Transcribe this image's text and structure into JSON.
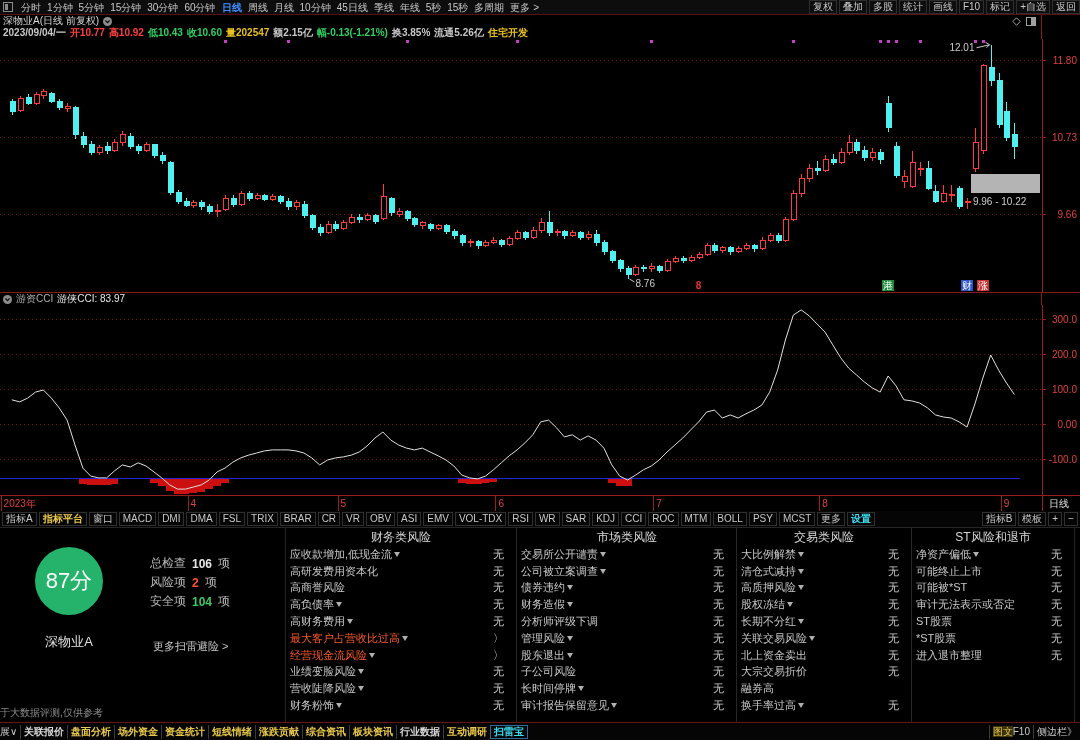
{
  "toolbar": {
    "periods": [
      {
        "label": "分时",
        "selected": false
      },
      {
        "label": "1分钟",
        "selected": false
      },
      {
        "label": "5分钟",
        "selected": false
      },
      {
        "label": "15分钟",
        "selected": false
      },
      {
        "label": "30分钟",
        "selected": false
      },
      {
        "label": "60分钟",
        "selected": false
      },
      {
        "label": "日线",
        "selected": true
      },
      {
        "label": "周线",
        "selected": false
      },
      {
        "label": "月线",
        "selected": false
      },
      {
        "label": "10分钟",
        "selected": false
      },
      {
        "label": "45日线",
        "selected": false
      },
      {
        "label": "季线",
        "selected": false
      },
      {
        "label": "年线",
        "selected": false
      },
      {
        "label": "5秒",
        "selected": false
      },
      {
        "label": "15秒",
        "selected": false
      },
      {
        "label": "多周期",
        "selected": false
      },
      {
        "label": "更多 >",
        "selected": false
      }
    ],
    "actions": [
      "复权",
      "叠加",
      "多股",
      "统计",
      "画线",
      "F10",
      "标记",
      "+自选",
      "返回"
    ]
  },
  "price_pane": {
    "title": "深物业A(日线 前复权)",
    "quote": [
      {
        "text": "2023/09/04/一",
        "color": "#c8c8c8"
      },
      {
        "text": "开10.77",
        "color": "#ff4040"
      },
      {
        "text": "高10.92",
        "color": "#ff4040"
      },
      {
        "text": "低10.43",
        "color": "#30d060"
      },
      {
        "text": "收10.60",
        "color": "#30d060"
      },
      {
        "text": "量202547",
        "color": "#e8c020"
      },
      {
        "text": "额2.15亿",
        "color": "#c8c8c8"
      },
      {
        "text": "幅-0.13(-1.21%)",
        "color": "#30d060"
      },
      {
        "text": "换3.85%",
        "color": "#c8c8c8"
      },
      {
        "text": "流通5.26亿",
        "color": "#c8c8c8"
      },
      {
        "text": "住宅开发",
        "color": "#e8c020"
      }
    ],
    "chart_data": {
      "type": "candlestick",
      "ylim": [
        8.58,
        12.09
      ],
      "yticks": [
        {
          "value": 11.8,
          "label": "11.80"
        },
        {
          "value": 10.73,
          "label": "10.73"
        },
        {
          "value": 9.66,
          "label": "9.66"
        }
      ],
      "tick_labels": "y",
      "grid": true,
      "ohlc": [
        null,
        [
          11.22,
          11.26,
          11.04,
          11.08
        ],
        [
          11.1,
          11.3,
          11.08,
          11.26
        ],
        [
          11.28,
          11.33,
          11.18,
          11.2
        ],
        [
          11.2,
          11.36,
          11.18,
          11.32
        ],
        [
          11.3,
          11.4,
          11.26,
          11.36
        ],
        [
          11.34,
          11.36,
          11.2,
          11.22
        ],
        [
          11.22,
          11.26,
          11.1,
          11.14
        ],
        [
          11.12,
          11.2,
          11.08,
          11.16
        ],
        [
          11.14,
          11.16,
          10.7,
          10.76
        ],
        [
          10.74,
          10.8,
          10.58,
          10.62
        ],
        [
          10.62,
          10.68,
          10.48,
          10.52
        ],
        [
          10.52,
          10.62,
          10.48,
          10.58
        ],
        [
          10.6,
          10.66,
          10.5,
          10.54
        ],
        [
          10.54,
          10.7,
          10.52,
          10.66
        ],
        [
          10.66,
          10.82,
          10.6,
          10.76
        ],
        [
          10.74,
          10.78,
          10.56,
          10.6
        ],
        [
          10.6,
          10.64,
          10.5,
          10.54
        ],
        [
          10.54,
          10.66,
          10.52,
          10.62
        ],
        [
          10.62,
          10.64,
          10.44,
          10.48
        ],
        [
          10.48,
          10.52,
          10.36,
          10.4
        ],
        [
          10.38,
          10.4,
          9.92,
          9.96
        ],
        [
          9.96,
          10.0,
          9.8,
          9.84
        ],
        [
          9.84,
          9.88,
          9.76,
          9.78
        ],
        [
          9.78,
          9.86,
          9.74,
          9.82
        ],
        [
          9.82,
          9.86,
          9.72,
          9.76
        ],
        [
          9.76,
          9.8,
          9.66,
          9.7
        ],
        [
          9.7,
          9.8,
          9.62,
          9.71
        ],
        [
          9.72,
          9.92,
          9.7,
          9.88
        ],
        [
          9.88,
          9.92,
          9.76,
          9.8
        ],
        [
          9.8,
          9.98,
          9.78,
          9.94
        ],
        [
          9.94,
          9.98,
          9.84,
          9.88
        ],
        [
          9.88,
          9.96,
          9.86,
          9.92
        ],
        [
          9.92,
          9.94,
          9.84,
          9.86
        ],
        [
          9.86,
          9.94,
          9.84,
          9.9
        ],
        [
          9.9,
          9.92,
          9.8,
          9.84
        ],
        [
          9.84,
          9.88,
          9.72,
          9.76
        ],
        [
          9.76,
          9.86,
          9.72,
          9.82
        ],
        [
          9.8,
          9.84,
          9.6,
          9.64
        ],
        [
          9.64,
          9.66,
          9.44,
          9.48
        ],
        [
          9.48,
          9.52,
          9.36,
          9.4
        ],
        [
          9.4,
          9.56,
          9.38,
          9.52
        ],
        [
          9.52,
          9.56,
          9.42,
          9.46
        ],
        [
          9.46,
          9.58,
          9.44,
          9.54
        ],
        [
          9.54,
          9.66,
          9.52,
          9.62
        ],
        [
          9.62,
          9.66,
          9.54,
          9.58
        ],
        [
          9.58,
          9.68,
          9.56,
          9.64
        ],
        [
          9.64,
          9.66,
          9.52,
          9.56
        ],
        [
          9.6,
          10.08,
          9.58,
          9.9
        ],
        [
          9.88,
          9.9,
          9.64,
          9.68
        ],
        [
          9.66,
          9.74,
          9.62,
          9.7
        ],
        [
          9.7,
          9.72,
          9.56,
          9.6
        ],
        [
          9.6,
          9.62,
          9.48,
          9.52
        ],
        [
          9.5,
          9.56,
          9.46,
          9.54
        ],
        [
          9.52,
          9.54,
          9.42,
          9.46
        ],
        [
          9.46,
          9.52,
          9.44,
          9.5
        ],
        [
          9.5,
          9.52,
          9.38,
          9.42
        ],
        [
          9.42,
          9.46,
          9.32,
          9.36
        ],
        [
          9.36,
          9.38,
          9.22,
          9.26
        ],
        [
          9.26,
          9.32,
          9.2,
          9.28
        ],
        [
          9.28,
          9.3,
          9.18,
          9.22
        ],
        [
          9.22,
          9.3,
          9.2,
          9.26
        ],
        [
          9.26,
          9.34,
          9.24,
          9.3
        ],
        [
          9.3,
          9.32,
          9.2,
          9.24
        ],
        [
          9.24,
          9.36,
          9.22,
          9.32
        ],
        [
          9.32,
          9.44,
          9.3,
          9.4
        ],
        [
          9.4,
          9.42,
          9.3,
          9.34
        ],
        [
          9.34,
          9.48,
          9.32,
          9.44
        ],
        [
          9.44,
          9.6,
          9.4,
          9.54
        ],
        [
          9.54,
          9.7,
          9.36,
          9.4
        ],
        [
          9.4,
          9.46,
          9.36,
          9.42
        ],
        [
          9.42,
          9.44,
          9.32,
          9.36
        ],
        [
          9.36,
          9.44,
          9.34,
          9.4
        ],
        [
          9.4,
          9.42,
          9.3,
          9.34
        ],
        [
          9.34,
          9.42,
          9.3,
          9.38
        ],
        [
          9.38,
          9.44,
          9.22,
          9.26
        ],
        [
          9.26,
          9.3,
          9.1,
          9.14
        ],
        [
          9.14,
          9.16,
          8.98,
          9.02
        ],
        [
          9.02,
          9.04,
          8.86,
          8.9
        ],
        [
          8.9,
          8.94,
          8.76,
          8.82
        ],
        [
          8.82,
          8.96,
          8.8,
          8.92
        ],
        [
          8.92,
          8.96,
          8.86,
          8.9
        ],
        [
          8.9,
          8.98,
          8.86,
          8.94
        ],
        [
          8.94,
          8.96,
          8.84,
          8.88
        ],
        [
          8.88,
          9.04,
          8.86,
          9.0
        ],
        [
          9.0,
          9.08,
          8.98,
          9.04
        ],
        [
          9.04,
          9.08,
          8.98,
          9.02
        ],
        [
          9.02,
          9.1,
          9.0,
          9.06
        ],
        [
          9.06,
          9.14,
          9.04,
          9.1
        ],
        [
          9.1,
          9.26,
          9.08,
          9.22
        ],
        [
          9.22,
          9.26,
          9.12,
          9.16
        ],
        [
          9.16,
          9.22,
          9.12,
          9.2
        ],
        [
          9.2,
          9.22,
          9.1,
          9.14
        ],
        [
          9.14,
          9.22,
          9.12,
          9.18
        ],
        [
          9.18,
          9.26,
          9.16,
          9.22
        ],
        [
          9.22,
          9.24,
          9.14,
          9.18
        ],
        [
          9.18,
          9.34,
          9.16,
          9.3
        ],
        [
          9.3,
          9.4,
          9.28,
          9.36
        ],
        [
          9.36,
          9.4,
          9.26,
          9.3
        ],
        [
          9.3,
          9.62,
          9.28,
          9.58
        ],
        [
          9.58,
          10.0,
          9.56,
          9.94
        ],
        [
          9.94,
          10.22,
          9.9,
          10.16
        ],
        [
          10.16,
          10.36,
          10.1,
          10.3
        ],
        [
          10.3,
          10.4,
          10.2,
          10.26
        ],
        [
          10.26,
          10.48,
          10.24,
          10.42
        ],
        [
          10.42,
          10.5,
          10.34,
          10.38
        ],
        [
          10.38,
          10.58,
          10.36,
          10.52
        ],
        [
          10.52,
          10.76,
          10.48,
          10.66
        ],
        [
          10.66,
          10.7,
          10.5,
          10.54
        ],
        [
          10.54,
          10.6,
          10.4,
          10.44
        ],
        [
          10.44,
          10.58,
          10.4,
          10.52
        ],
        [
          10.52,
          10.56,
          10.36,
          10.42
        ],
        [
          11.2,
          11.3,
          10.8,
          10.86
        ],
        [
          10.6,
          10.66,
          10.16,
          10.2
        ],
        [
          10.11,
          10.27,
          10.02,
          10.18
        ],
        [
          10.05,
          10.54,
          10.02,
          10.37
        ],
        [
          10.28,
          10.38,
          10.19,
          10.3
        ],
        [
          10.3,
          10.4,
          10.0,
          10.02
        ],
        [
          9.97,
          10.07,
          9.82,
          9.84
        ],
        [
          9.84,
          10.07,
          9.82,
          9.94
        ],
        [
          9.92,
          10.07,
          9.83,
          9.93
        ],
        [
          10.01,
          10.05,
          9.73,
          9.76
        ],
        [
          9.82,
          9.89,
          9.73,
          9.84
        ],
        [
          10.29,
          10.85,
          10.25,
          10.65
        ],
        [
          10.55,
          11.74,
          10.5,
          11.72
        ],
        [
          11.7,
          12.01,
          11.44,
          11.52
        ],
        [
          11.51,
          11.62,
          10.86,
          10.9
        ],
        [
          11.08,
          11.21,
          10.67,
          10.73
        ],
        [
          10.77,
          10.92,
          10.43,
          10.6
        ],
        null,
        null,
        null
      ],
      "bands": [
        {
          "axis": "y",
          "from": 9.96,
          "to": 10.22,
          "label": "9.96 - 10.22",
          "color": "#b4b4b4"
        }
      ],
      "annotations": [
        "12.01",
        "8.76"
      ]
    },
    "event_tags": [
      {
        "text": "8",
        "kind": "text",
        "color": "#e83030"
      },
      {
        "text": "港",
        "kind": "tag",
        "color": "#1e8a3c"
      },
      {
        "text": "财",
        "kind": "tag",
        "color": "#2c56c8"
      },
      {
        "text": "涨",
        "kind": "tag",
        "color": "#c83232"
      }
    ]
  },
  "cci_pane": {
    "indicator": "游资CCI",
    "reading": "游侠CCI: 83.97",
    "period_label": "日线",
    "chart_data": {
      "type": "line",
      "ylim": [
        -203,
        340
      ],
      "yticks": [
        {
          "value": 300,
          "label": "300.0"
        },
        {
          "value": 200,
          "label": "200.0"
        },
        {
          "value": 100,
          "label": "100.0"
        },
        {
          "value": 0,
          "label": "0.00"
        },
        {
          "value": -100,
          "label": "-100.0"
        }
      ],
      "grid": true,
      "categories": [
        null,
        null,
        "2023年",
        null,
        null,
        null,
        null,
        null,
        null,
        null,
        null,
        null,
        null,
        null,
        null,
        null,
        null,
        null,
        null,
        null,
        null,
        null,
        null,
        null,
        "4",
        null,
        null,
        null,
        null,
        null,
        null,
        null,
        null,
        null,
        null,
        null,
        null,
        null,
        null,
        null,
        null,
        null,
        null,
        "5",
        null,
        null,
        null,
        null,
        null,
        null,
        null,
        null,
        null,
        null,
        null,
        null,
        null,
        null,
        null,
        null,
        null,
        null,
        null,
        "6",
        null,
        null,
        null,
        null,
        null,
        null,
        null,
        null,
        null,
        null,
        null,
        null,
        null,
        null,
        null,
        null,
        null,
        null,
        null,
        "7",
        null,
        null,
        null,
        null,
        null,
        null,
        null,
        null,
        null,
        null,
        null,
        null,
        null,
        null,
        null,
        null,
        null,
        null,
        null,
        null,
        "8",
        null,
        null,
        null,
        null,
        null,
        null,
        null,
        null,
        null,
        null,
        null,
        null,
        null,
        null,
        null,
        null,
        null,
        null,
        null,
        null,
        null,
        null,
        "9",
        null,
        null,
        null,
        null
      ],
      "ref_lines": [
        {
          "axis": "y",
          "value": -155,
          "color": "#2424d8"
        }
      ],
      "series": [
        {
          "type": "bar",
          "color": "#cc1010",
          "base": [
            null,
            null,
            null,
            null,
            null,
            null,
            null,
            null,
            null,
            null,
            -155,
            -155,
            -155,
            -155,
            -155,
            null,
            null,
            null,
            null,
            -155,
            -155,
            -155,
            -155,
            -155,
            -155,
            -155,
            -155,
            -155,
            -155,
            null,
            null,
            null,
            null,
            null,
            null,
            null,
            null,
            null,
            null,
            null,
            null,
            null,
            null,
            null,
            null,
            null,
            null,
            null,
            null,
            null,
            null,
            null,
            null,
            null,
            null,
            null,
            null,
            null,
            -155,
            -155,
            -155,
            -155,
            -155,
            null,
            null,
            null,
            null,
            null,
            null,
            null,
            null,
            null,
            null,
            null,
            null,
            null,
            null,
            -155,
            -155,
            -155,
            null,
            null,
            null,
            null,
            null,
            null,
            null,
            null,
            null,
            null,
            null,
            null,
            null,
            null,
            null,
            null,
            null,
            null,
            null,
            null,
            null,
            null,
            null,
            null,
            null,
            null,
            null,
            null,
            null,
            null,
            null,
            null,
            null,
            null,
            null,
            null,
            null,
            null,
            null,
            null,
            null,
            null,
            null,
            null,
            null,
            null,
            null,
            null,
            null,
            null,
            null,
            null
          ],
          "values": [
            null,
            null,
            null,
            null,
            null,
            null,
            null,
            null,
            null,
            null,
            -17,
            -20,
            -20,
            -20,
            -17,
            null,
            null,
            null,
            null,
            -13,
            -21,
            -37,
            -45,
            -45,
            -43,
            -39,
            -31,
            -21,
            -15,
            null,
            null,
            null,
            null,
            null,
            null,
            null,
            null,
            null,
            null,
            null,
            null,
            null,
            null,
            null,
            null,
            null,
            null,
            null,
            null,
            null,
            null,
            null,
            null,
            null,
            null,
            null,
            null,
            null,
            -13,
            -17,
            -17,
            -15,
            -11,
            null,
            null,
            null,
            null,
            null,
            null,
            null,
            null,
            null,
            null,
            null,
            null,
            null,
            null,
            -15,
            -21,
            -21,
            null,
            null,
            null,
            null,
            null,
            null,
            null,
            null,
            null,
            null,
            null,
            null,
            null,
            null,
            null,
            null,
            null,
            null,
            null,
            null,
            null,
            null,
            null,
            null,
            null,
            null,
            null,
            null,
            null,
            null,
            null,
            null,
            null,
            null,
            null,
            null,
            null,
            null,
            null,
            null,
            null,
            null,
            null,
            null,
            null,
            null,
            null,
            null,
            null,
            null,
            null,
            null
          ]
        },
        {
          "type": "line",
          "color": "#e0e0e0",
          "values": [
            null,
            69,
            63,
            74,
            91,
            97,
            74,
            46,
            11,
            -60,
            -126,
            -149,
            -154,
            -154,
            -134,
            -117,
            -123,
            -111,
            -120,
            -137,
            -154,
            -174,
            -186,
            -186,
            -180,
            -174,
            -160,
            -137,
            -126,
            -109,
            -97,
            -89,
            -83,
            -77,
            -74,
            -74,
            -74,
            -77,
            -83,
            -97,
            -117,
            -103,
            -97,
            -94,
            -89,
            -80,
            -63,
            -40,
            -23,
            -46,
            -60,
            -69,
            -74,
            -69,
            -80,
            -91,
            -103,
            -120,
            -146,
            -154,
            -157,
            -149,
            -131,
            -111,
            -91,
            -74,
            -54,
            -31,
            6,
            11,
            -11,
            -37,
            -31,
            -46,
            -34,
            -46,
            -69,
            -117,
            -149,
            -160,
            -146,
            -131,
            -120,
            -103,
            -80,
            -60,
            -40,
            -17,
            6,
            34,
            40,
            17,
            26,
            17,
            29,
            40,
            54,
            91,
            154,
            240,
            311,
            326,
            309,
            286,
            263,
            226,
            189,
            160,
            140,
            120,
            103,
            91,
            137,
            109,
            69,
            66,
            60,
            46,
            26,
            20,
            17,
            6,
            -9,
            57,
            131,
            197,
            154,
            117,
            84,
            null,
            null,
            null
          ]
        }
      ]
    }
  },
  "indicator_bar": {
    "left": [
      {
        "label": "指标A"
      },
      {
        "label": "指标平台",
        "color": "#e8c84a"
      },
      {
        "label": "窗口"
      },
      {
        "label": "MACD"
      },
      {
        "label": "DMI"
      },
      {
        "label": "DMA"
      },
      {
        "label": "FSL"
      },
      {
        "label": "TRIX"
      },
      {
        "label": "BRAR"
      },
      {
        "label": "CR"
      },
      {
        "label": "VR"
      },
      {
        "label": "OBV"
      },
      {
        "label": "ASI"
      },
      {
        "label": "EMV"
      },
      {
        "label": "VOL-TDX"
      },
      {
        "label": "RSI"
      },
      {
        "label": "WR"
      },
      {
        "label": "SAR"
      },
      {
        "label": "KDJ"
      },
      {
        "label": "CCI"
      },
      {
        "label": "ROC"
      },
      {
        "label": "MTM"
      },
      {
        "label": "BOLL"
      },
      {
        "label": "PSY"
      },
      {
        "label": "MCST"
      },
      {
        "label": "更多"
      },
      {
        "label": "设置",
        "color": "#3cdcf0"
      }
    ],
    "right": [
      {
        "label": "指标B"
      },
      {
        "label": "模板"
      },
      {
        "label": "+"
      },
      {
        "label": "−"
      }
    ]
  },
  "risk_panel": {
    "score": "87分",
    "stock": "深物业A",
    "stats": [
      {
        "label": "总检查",
        "value": "106",
        "unit": "项",
        "color": "#e6e6e6"
      },
      {
        "label": "风险项",
        "value": "2",
        "unit": "项",
        "color": "#ff5032"
      },
      {
        "label": "安全项",
        "value": "104",
        "unit": "项",
        "color": "#3cc864"
      }
    ],
    "more_link": "更多扫雷避险 >",
    "footnote": "于大数据评测,仅供参考",
    "groups": [
      {
        "title": "财务类风险",
        "items": [
          {
            "label": "应收款增加,低现金流",
            "expandable": true,
            "risk": false,
            "status": "无"
          },
          {
            "label": "高研发费用资本化",
            "expandable": false,
            "risk": false,
            "status": "无"
          },
          {
            "label": "高商誉风险",
            "expandable": false,
            "risk": false,
            "status": "无"
          },
          {
            "label": "高负债率",
            "expandable": true,
            "risk": false,
            "status": "无"
          },
          {
            "label": "高财务费用",
            "expandable": true,
            "risk": false,
            "status": "无"
          },
          {
            "label": "最大客户占营收比过高",
            "expandable": true,
            "risk": true,
            "status": "〉"
          },
          {
            "label": "经营现金流风险",
            "expandable": true,
            "risk": true,
            "status": "〉"
          },
          {
            "label": "业绩变脸风险",
            "expandable": true,
            "risk": false,
            "status": "无"
          },
          {
            "label": "营收陡降风险",
            "expandable": true,
            "risk": false,
            "status": "无"
          },
          {
            "label": "财务粉饰",
            "expandable": true,
            "risk": false,
            "status": "无"
          }
        ]
      },
      {
        "title": "市场类风险",
        "items": [
          {
            "label": "交易所公开谴责",
            "expandable": true,
            "risk": false,
            "status": "无"
          },
          {
            "label": "公司被立案调查",
            "expandable": true,
            "risk": false,
            "status": "无"
          },
          {
            "label": "债券违约",
            "expandable": true,
            "risk": false,
            "status": "无"
          },
          {
            "label": "财务造假",
            "expandable": true,
            "risk": false,
            "status": "无"
          },
          {
            "label": "分析师评级下调",
            "expandable": false,
            "risk": false,
            "status": "无"
          },
          {
            "label": "管理风险",
            "expandable": true,
            "risk": false,
            "status": "无"
          },
          {
            "label": "股东退出",
            "expandable": true,
            "risk": false,
            "status": "无"
          },
          {
            "label": "子公司风险",
            "expandable": false,
            "risk": false,
            "status": "无"
          },
          {
            "label": "长时间停牌",
            "expandable": true,
            "risk": false,
            "status": "无"
          },
          {
            "label": "审计报告保留意见",
            "expandable": true,
            "risk": false,
            "status": "无"
          }
        ]
      },
      {
        "title": "交易类风险",
        "items": [
          {
            "label": "大比例解禁",
            "expandable": true,
            "risk": false,
            "status": "无"
          },
          {
            "label": "清仓式减持",
            "expandable": true,
            "risk": false,
            "status": "无"
          },
          {
            "label": "高质押风险",
            "expandable": true,
            "risk": false,
            "status": "无"
          },
          {
            "label": "股权冻结",
            "expandable": true,
            "risk": false,
            "status": "无"
          },
          {
            "label": "长期不分红",
            "expandable": true,
            "risk": false,
            "status": "无"
          },
          {
            "label": "关联交易风险",
            "expandable": true,
            "risk": false,
            "status": "无"
          },
          {
            "label": "北上资金卖出",
            "expandable": false,
            "risk": false,
            "status": "无"
          },
          {
            "label": "大宗交易折价",
            "expandable": false,
            "risk": false,
            "status": "无"
          },
          {
            "label": "融券高",
            "expandable": false,
            "risk": false
          },
          {
            "label": "换手率过高",
            "expandable": true,
            "risk": false,
            "status": "无"
          }
        ]
      },
      {
        "title": "ST风险和退市",
        "items": [
          {
            "label": "净资产偏低",
            "expandable": true,
            "risk": false,
            "status": "无"
          },
          {
            "label": "可能终止上市",
            "expandable": false,
            "risk": false,
            "status": "无"
          },
          {
            "label": "可能被*ST",
            "expandable": false,
            "risk": false,
            "status": "无"
          },
          {
            "label": "审计无法表示或否定",
            "expandable": false,
            "risk": false,
            "status": "无"
          },
          {
            "label": "ST股票",
            "expandable": false,
            "risk": false,
            "status": "无"
          },
          {
            "label": "*ST股票",
            "expandable": false,
            "risk": false,
            "status": "无"
          },
          {
            "label": "进入退市整理",
            "expandable": false,
            "risk": false,
            "status": "无"
          }
        ]
      }
    ]
  },
  "bottom_tabs": {
    "lead": "展∨",
    "tabs": [
      {
        "label": "关联报价",
        "color": "#d8d8d8",
        "selected": false
      },
      {
        "label": "盘面分析",
        "color": "#e8c84a",
        "selected": false
      },
      {
        "label": "场外资金",
        "color": "#e8c84a",
        "selected": false
      },
      {
        "label": "资金统计",
        "color": "#e8c84a",
        "selected": false
      },
      {
        "label": "短线情绪",
        "color": "#e8c84a",
        "selected": false
      },
      {
        "label": "涨跌贡献",
        "color": "#e8c84a",
        "selected": false
      },
      {
        "label": "综合资讯",
        "color": "#e8c84a",
        "selected": false
      },
      {
        "label": "板块资讯",
        "color": "#e8c84a",
        "selected": false
      },
      {
        "label": "行业数据",
        "color": "#d8d8d8",
        "selected": false
      },
      {
        "label": "互动调研",
        "color": "#e8c84a",
        "selected": false
      },
      {
        "label": "扫雷宝",
        "color": "#3cdcf0",
        "selected": true
      }
    ],
    "f10": {
      "label": "图文",
      "suffix": "F10"
    },
    "sidebar": "侧边栏》"
  }
}
